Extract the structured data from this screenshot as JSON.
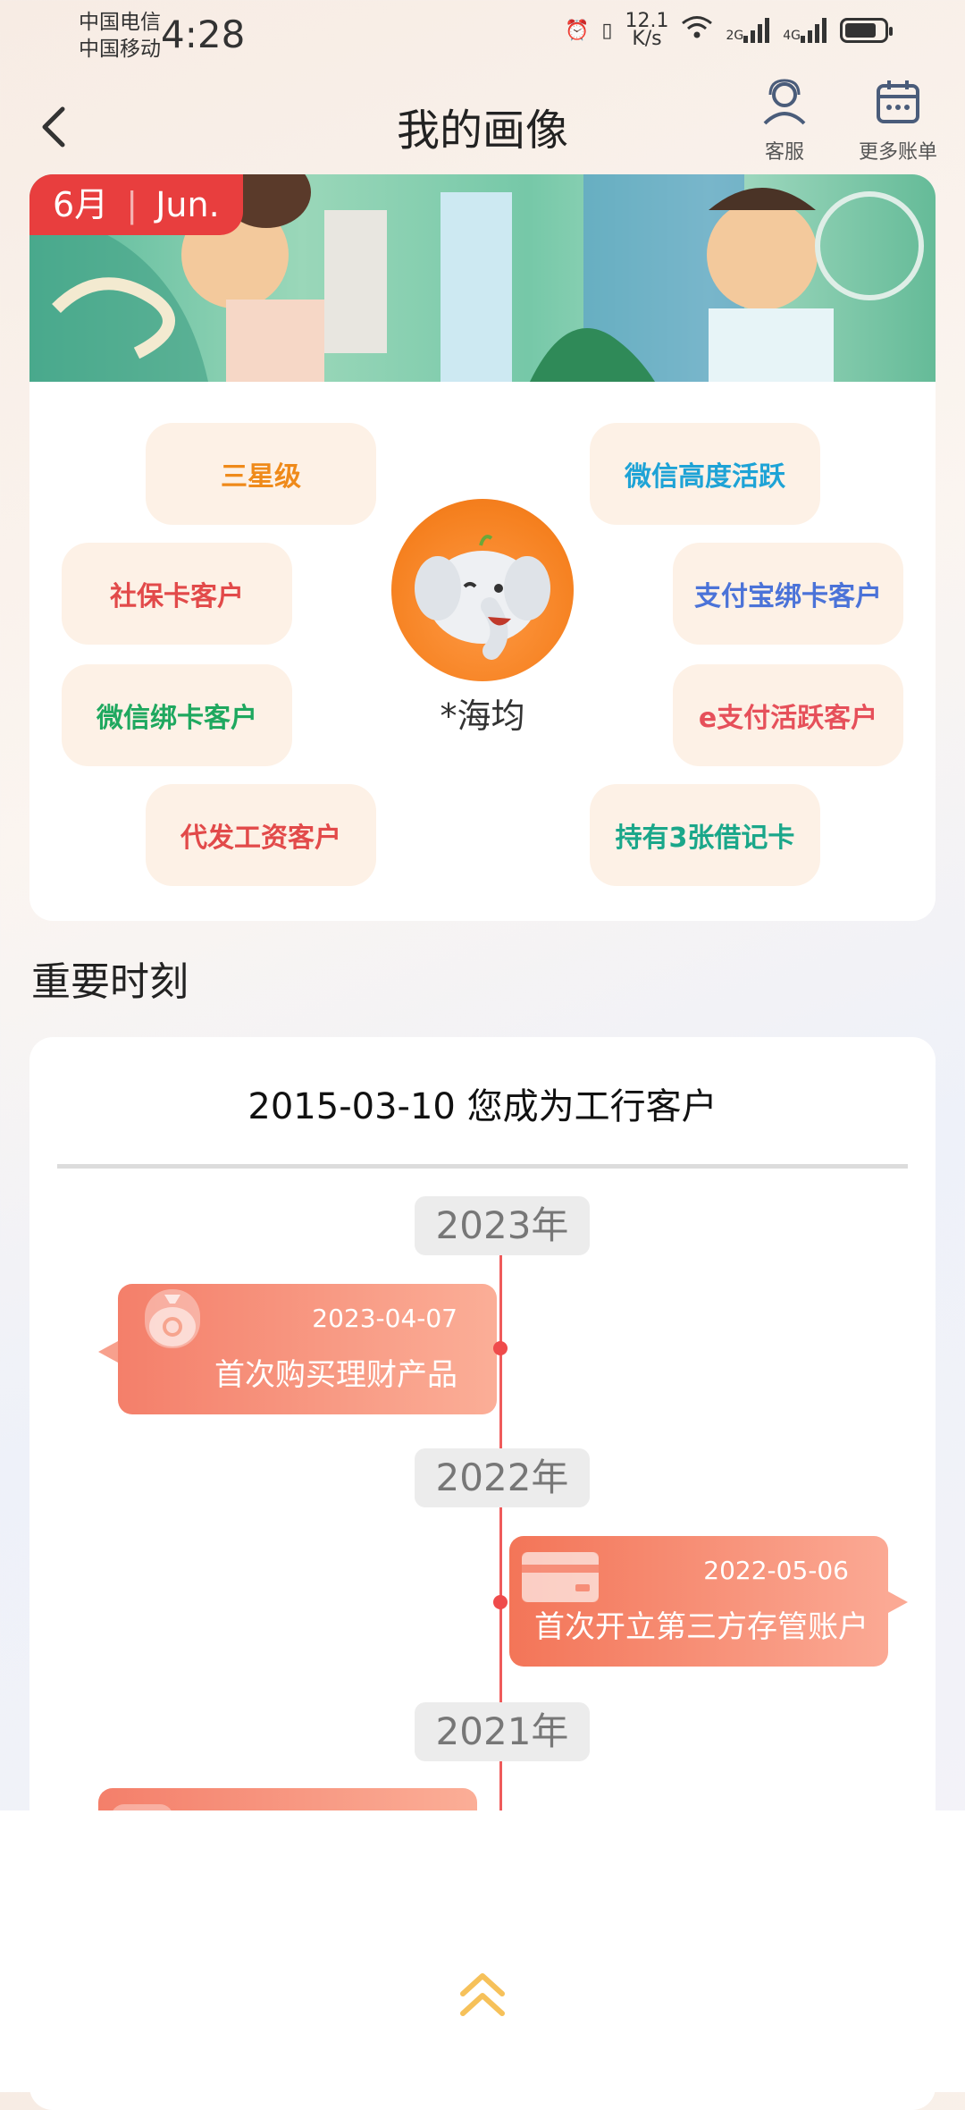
{
  "status_bar": {
    "carrier1": "中国电信",
    "carrier2": "中国移动",
    "time": "4:28",
    "speed": "12.1",
    "speed_unit": "K/s",
    "net1": "2G",
    "net2": "4G"
  },
  "header": {
    "title": "我的画像",
    "service_label": "客服",
    "more_bills_label": "更多账单"
  },
  "banner": {
    "month_cn": "6月",
    "month_en": "Jun."
  },
  "profile": {
    "username": "*海均",
    "tags": [
      {
        "text": "三星级",
        "color": "#ef8a1a"
      },
      {
        "text": "微信高度活跃",
        "color": "#1ea3d6"
      },
      {
        "text": "社保卡客户",
        "color": "#e24a4a"
      },
      {
        "text": "支付宝绑卡客户",
        "color": "#4b73d8"
      },
      {
        "text": "微信绑卡客户",
        "color": "#1fa85f"
      },
      {
        "text": "e支付活跃客户",
        "color": "#e6505a"
      },
      {
        "text": "代发工资客户",
        "color": "#e24a4a"
      },
      {
        "text": "持有3张借记卡",
        "color": "#1aa78a"
      }
    ]
  },
  "moments": {
    "section_title": "重要时刻",
    "first_line": "2015-03-10 您成为工行客户",
    "years": [
      "2023年",
      "2022年",
      "2021年"
    ],
    "events": [
      {
        "date": "2023-04-07",
        "label": "首次购买理财产品",
        "icon": "money-bag-icon"
      },
      {
        "date": "2022-05-06",
        "label": "首次开立第三方存管账户",
        "icon": "bank-card-icon"
      }
    ]
  }
}
